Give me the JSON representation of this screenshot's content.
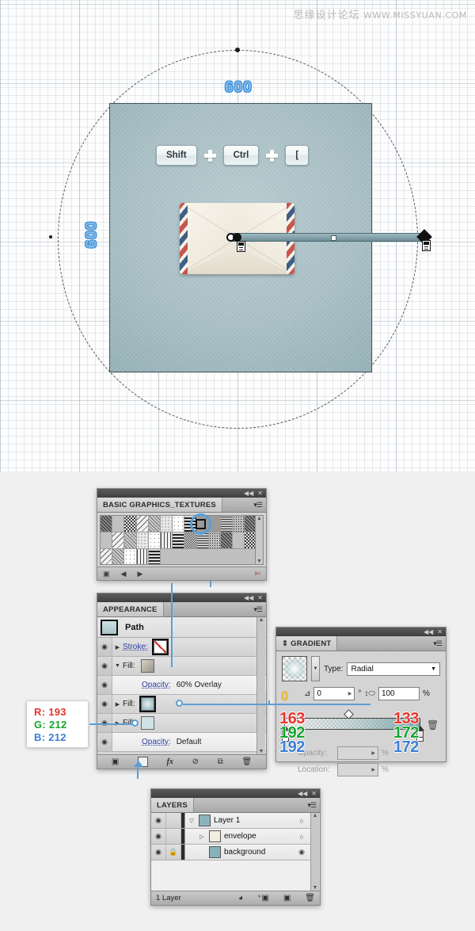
{
  "watermark": {
    "cn": "思缘设计论坛",
    "url": "WWW.MISSYUAN.COM"
  },
  "canvas": {
    "measure_top": "600",
    "measure_left": "600",
    "shortcut_keys": [
      "Shift",
      "Ctrl",
      "["
    ],
    "plus_glyph": "plus-icon",
    "envelope_name": "airmail-envelope",
    "magnifier_name": "texture-detail-magnifier"
  },
  "textures_panel": {
    "title": "BASIC GRAPHICS_TEXTURES",
    "collapse_glyph": "◀◀",
    "close_glyph": "✕",
    "menu_glyph": "▾☰",
    "swatch_rows": 3,
    "swatch_cols": 13,
    "swatch_last_row_count": 5,
    "selected_swatch_index": 8,
    "bottom_icons": [
      "new-swatch-icon",
      "prev-icon",
      "next-icon",
      "delete-icon"
    ],
    "bottom_glyphs": [
      "▣",
      "◀",
      "▶",
      "✄"
    ]
  },
  "appearance_panel": {
    "title": "APPEARANCE",
    "collapse_glyph": "◀◀",
    "close_glyph": "✕",
    "menu_glyph": "▾☰",
    "object_label": "Path",
    "rows": [
      {
        "label": "Stroke:",
        "value": "",
        "arrow": "▶",
        "chip": "stroke-none",
        "underline": true
      },
      {
        "label": "Fill:",
        "value": "",
        "arrow": "▼",
        "chip": "fill-texture",
        "underline": false
      },
      {
        "label": "Opacity:",
        "value": "60% Overlay",
        "arrow": "",
        "chip": "",
        "underline": true
      },
      {
        "label": "Fill:",
        "value": "",
        "arrow": "▶",
        "chip": "fill-gradient",
        "underline": false
      },
      {
        "label": "Fill:",
        "value": "",
        "arrow": "▶",
        "chip": "fill-solid",
        "underline": false
      },
      {
        "label": "Opacity:",
        "value": "Default",
        "arrow": "",
        "chip": "",
        "underline": true
      }
    ],
    "bottom_icons": [
      "add-new-stroke-icon",
      "add-new-fill-icon",
      "add-effect-icon",
      "clear-appearance-icon",
      "duplicate-item-icon",
      "delete-item-icon"
    ],
    "bottom_glyphs": [
      "▣",
      "▢",
      "fx",
      "⊘",
      "⧉",
      "🗑"
    ]
  },
  "gradient_panel": {
    "title": "GRADIENT",
    "collapse_glyph": "◀◀",
    "close_glyph": "✕",
    "menu_glyph": "▾☰",
    "dock_glyph": "⇕",
    "type_label": "Type:",
    "type_value": "Radial",
    "angle_value": "0",
    "angle_unit": "°",
    "aspect_value": "100",
    "aspect_unit": "%",
    "stepper_glyph": "▶",
    "opacity_label": "Opacity:",
    "opacity_unit": "%",
    "location_label": "Location:",
    "location_unit": "%",
    "delete_stop_glyph": "🗑",
    "reverse_icon": "reverse-gradient-icon",
    "stop_left": {
      "r": "163",
      "g": "192",
      "b": "192"
    },
    "stop_right": {
      "r": "133",
      "g": "172",
      "b": "172"
    }
  },
  "rgb_callout": {
    "r_label": "R:",
    "r_value": "193",
    "g_label": "G:",
    "g_value": "212",
    "b_label": "B:",
    "b_value": "212"
  },
  "layers_panel": {
    "title": "LAYERS",
    "collapse_glyph": "◀◀",
    "close_glyph": "✕",
    "menu_glyph": "▾☰",
    "eye_glyph": "👁",
    "lock_glyph": "🔒",
    "rows": [
      {
        "name": "Layer 1",
        "indent": 0,
        "tri": "▽",
        "thumb": "#8ab4bc",
        "target": "○",
        "locked": false
      },
      {
        "name": "envelope",
        "indent": 1,
        "tri": "▷",
        "thumb": "#f3eee2",
        "target": "○",
        "locked": false
      },
      {
        "name": "background",
        "indent": 1,
        "tri": "",
        "thumb": "#86b2ba",
        "target": "◉",
        "locked": true
      }
    ],
    "footer_count": "1 Layer",
    "footer_icons": [
      "make-clipping-mask-icon",
      "create-new-sublayer-icon",
      "create-new-layer-icon",
      "delete-selection-icon"
    ],
    "footer_glyphs": [
      "◕",
      "⁺▣",
      "▣",
      "🗑"
    ]
  },
  "colors": {
    "accent_blue": "#5a9ed6",
    "panel_bg": "#d4d4d4",
    "canvas_teal": "#a9c0c6",
    "label_blue": "#7fb8e8"
  }
}
